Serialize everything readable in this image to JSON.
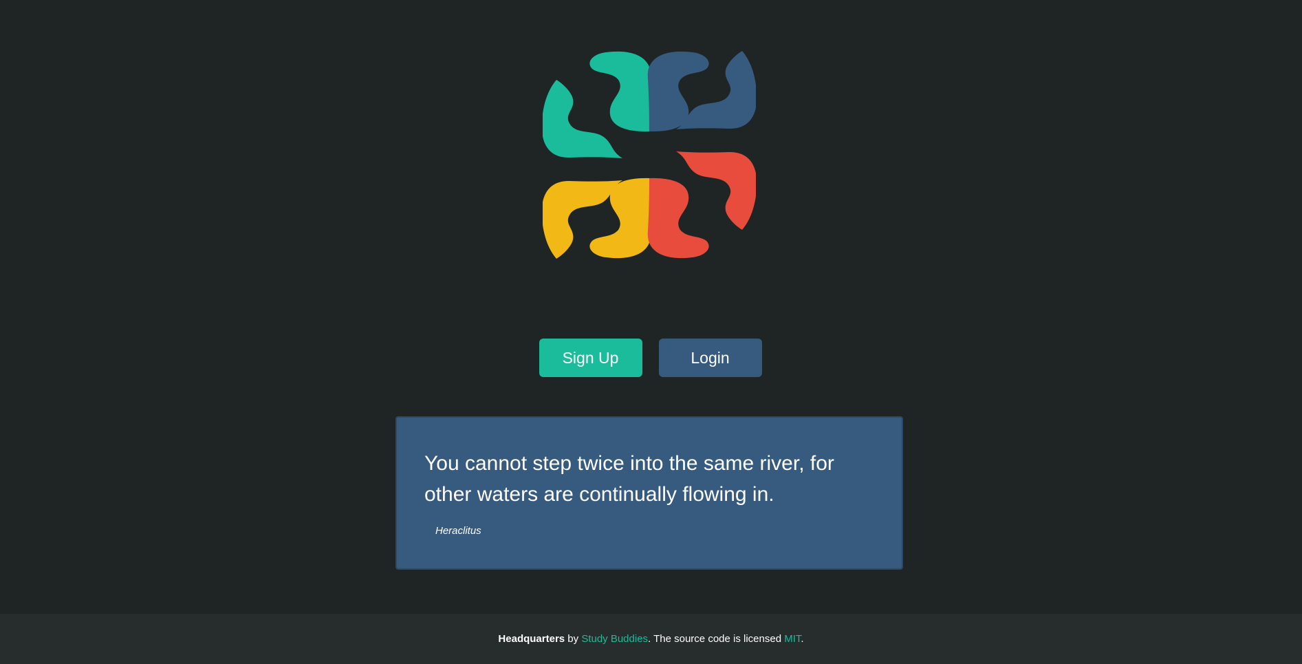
{
  "brand": {
    "logo_colors": {
      "teal": "#1abc9c",
      "blue": "#375a7f",
      "red": "#e74c3c",
      "yellow": "#f1b816"
    }
  },
  "actions": {
    "signup_label": "Sign Up",
    "login_label": "Login"
  },
  "quote": {
    "text": "You cannot step twice into the same river, for other waters are continually flowing in.",
    "author": "Heraclitus"
  },
  "footer": {
    "app_name": "Headquarters",
    "by_text": " by ",
    "org_link": "Study Buddies",
    "license_text": ". The source code is licensed ",
    "license_link": "MIT",
    "end_text": "."
  },
  "colors": {
    "background": "#1f2424",
    "footer_bg": "#272c2c",
    "primary": "#1abc9c",
    "secondary": "#375a7f"
  }
}
